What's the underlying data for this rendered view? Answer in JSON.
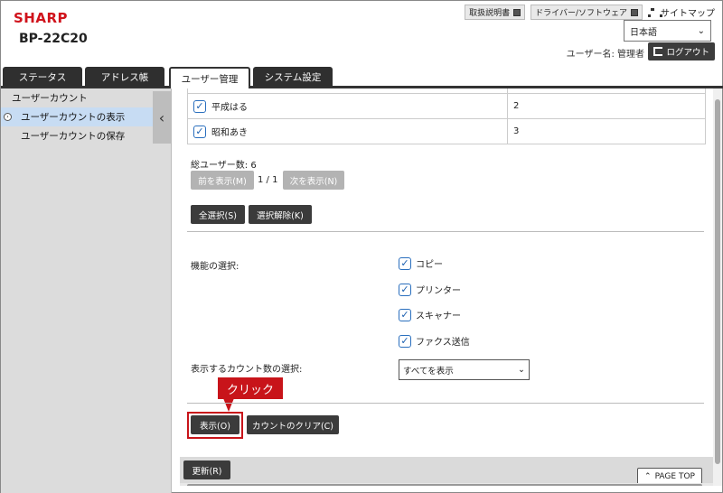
{
  "header": {
    "logo": "SHARP",
    "model": "BP-22C20",
    "links": [
      "取扱説明書",
      "ドライバー/ソフトウェア"
    ],
    "sitemap": "サイトマップ",
    "language": "日本語",
    "user_label": "ユーザー名: 管理者",
    "logout": "ログアウト"
  },
  "tabs": [
    {
      "label": "ステータス"
    },
    {
      "label": "アドレス帳"
    },
    {
      "label": "ユーザー管理"
    },
    {
      "label": "システム設定"
    }
  ],
  "sidebar": {
    "items": [
      {
        "label": "ユーザーカウント"
      },
      {
        "label": "ユーザーカウントの表示"
      },
      {
        "label": "ユーザーカウントの保存"
      }
    ]
  },
  "users": {
    "rows": [
      {
        "name": "平成はる",
        "value": "2"
      },
      {
        "name": "昭和あき",
        "value": "3"
      }
    ],
    "total": "総ユーザー数: 6",
    "prev": "前を表示(M)",
    "page": "1 / 1",
    "next": "次を表示(N)",
    "select_all": "全選択(S)",
    "deselect": "選択解除(K)"
  },
  "functions": {
    "label": "機能の選択:",
    "items": [
      "コピー",
      "プリンター",
      "スキャナー",
      "ファクス送信"
    ]
  },
  "count_select": {
    "label": "表示するカウント数の選択:",
    "value": "すべてを表示"
  },
  "callout": "クリック",
  "actions": {
    "show": "表示(O)",
    "clear": "カウントのクリア(C)",
    "refresh": "更新(R)",
    "page_top": "PAGE TOP"
  }
}
